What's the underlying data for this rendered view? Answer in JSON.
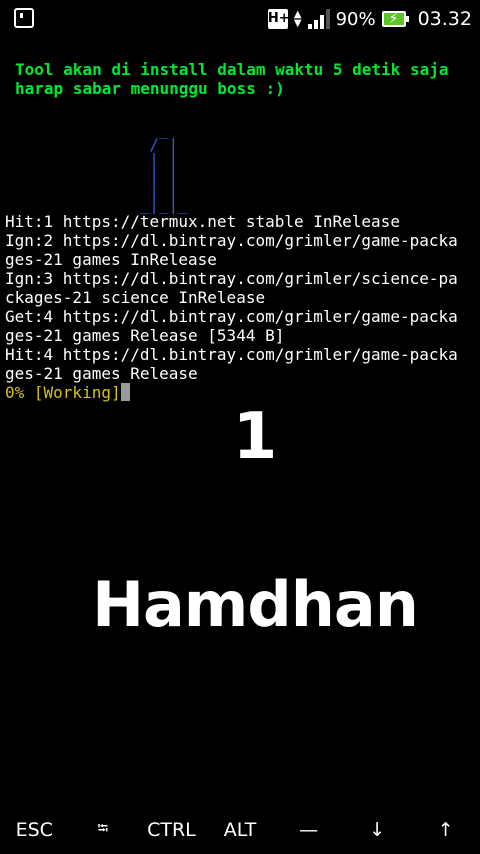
{
  "status_bar": {
    "network": "H+",
    "battery": "90%",
    "time": "03.32"
  },
  "terminal": {
    "intro": [
      "Tool akan di install dalam waktu 5 detik saja",
      "harap sabar menunggu boss :)"
    ],
    "ascii_art": "   _\n  / |\n  | |\n  | |\n  | |\n _|_|_",
    "lines": [
      "Hit:1 https://termux.net stable InRelease",
      "Ign:2 https://dl.bintray.com/grimler/game-packa",
      "ges-21 games InRelease",
      "Ign:3 https://dl.bintray.com/grimler/science-pa",
      "ckages-21 science InRelease",
      "Get:4 https://dl.bintray.com/grimler/game-packa",
      "ges-21 games Release [5344 B]",
      "Hit:4 https://dl.bintray.com/grimler/game-packa",
      "ges-21 games Release"
    ],
    "progress": "0% [Working]"
  },
  "overlay": {
    "number": "1",
    "name": "Hamdhan"
  },
  "extra_keys": [
    "ESC",
    "⭾",
    "CTRL",
    "ALT",
    "—",
    "↓",
    "↑"
  ]
}
